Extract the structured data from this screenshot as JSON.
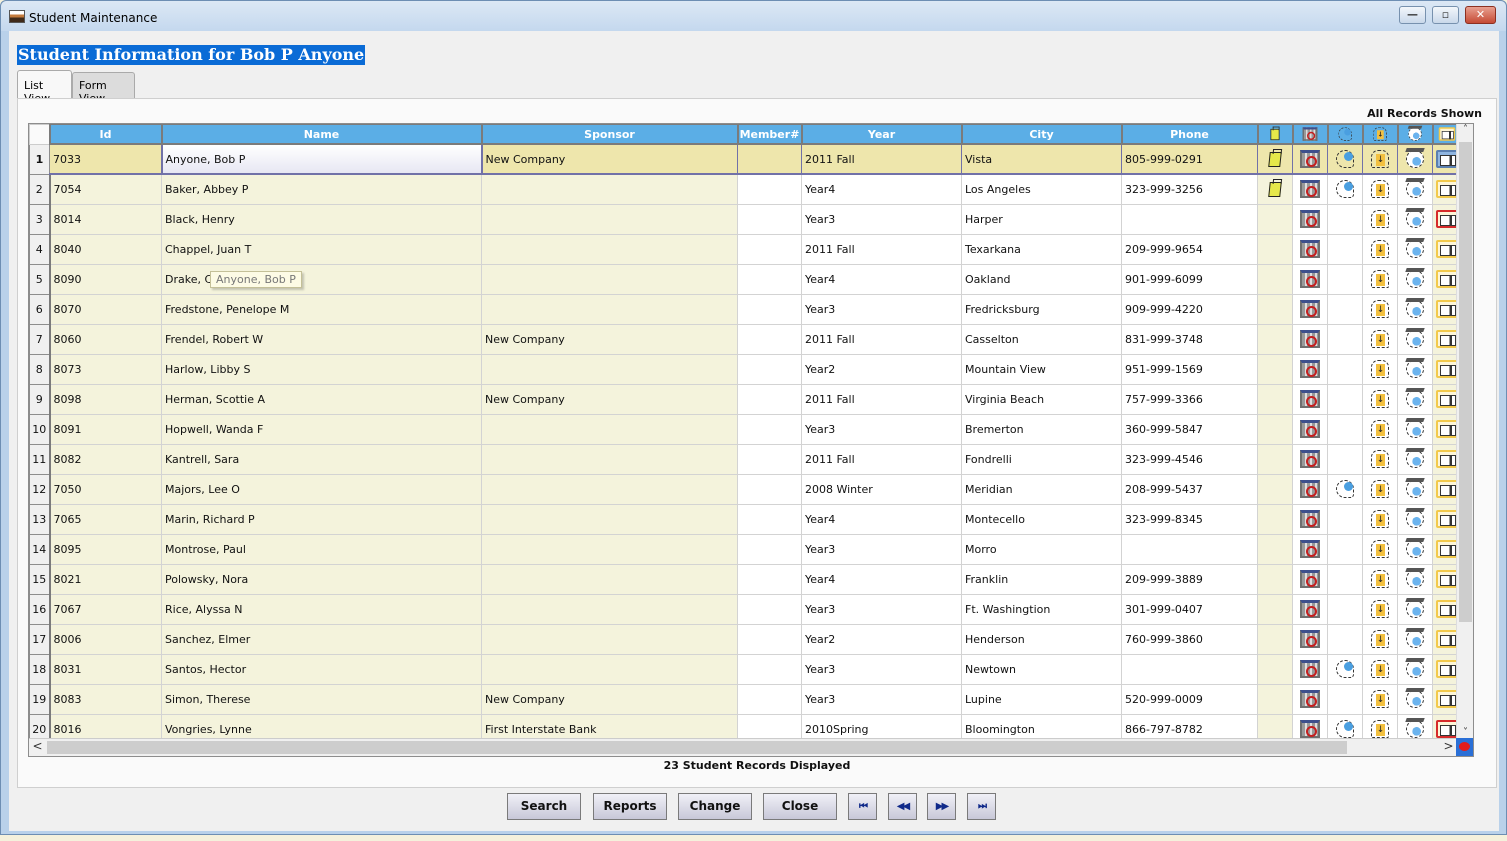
{
  "window": {
    "title": "Student Maintenance",
    "controls": {
      "minimize": "—",
      "maximize": "▫",
      "close": "✕"
    }
  },
  "header": {
    "title": "Student Information  for Bob P Anyone"
  },
  "tabs": [
    {
      "label": "List View",
      "active": true
    },
    {
      "label": "Form View",
      "active": false
    }
  ],
  "grid": {
    "records_shown_label": "All Records Shown",
    "columns": [
      "Id",
      "Name",
      "Sponsor",
      "Member#",
      "Year",
      "City",
      "Phone"
    ],
    "icon_columns": [
      "notes-icon",
      "calendar-icon",
      "contact-icon",
      "enrollment-icon",
      "graduation-icon",
      "card-icon"
    ],
    "selected_row": 1,
    "tooltip": "Anyone, Bob P",
    "rows": [
      {
        "num": "1",
        "id": "7033",
        "name": "Anyone, Bob P",
        "sponsor": "New Company",
        "member": "",
        "year": "2011 Fall",
        "city": "Vista",
        "phone": "805-999-0291",
        "notes": true,
        "contact": true,
        "card": "blue"
      },
      {
        "num": "2",
        "id": "7054",
        "name": "Baker, Abbey P",
        "sponsor": "",
        "member": "",
        "year": "Year4",
        "city": "Los Angeles",
        "phone": "323-999-3256",
        "notes": true,
        "contact": true,
        "card": "yellow"
      },
      {
        "num": "3",
        "id": "8014",
        "name": "Black, Henry",
        "sponsor": "",
        "member": "",
        "year": "Year3",
        "city": "Harper",
        "phone": "",
        "notes": false,
        "contact": false,
        "card": "red"
      },
      {
        "num": "4",
        "id": "8040",
        "name": "Chappel, Juan T",
        "sponsor": "",
        "member": "",
        "year": "2011 Fall",
        "city": "Texarkana",
        "phone": "209-999-9654",
        "notes": false,
        "contact": false,
        "card": "yellow"
      },
      {
        "num": "5",
        "id": "8090",
        "name": "Drake, Cynthia",
        "sponsor": "",
        "member": "",
        "year": "Year4",
        "city": "Oakland",
        "phone": "901-999-6099",
        "notes": false,
        "contact": false,
        "card": "yellow"
      },
      {
        "num": "6",
        "id": "8070",
        "name": "Fredstone, Penelope M",
        "sponsor": "",
        "member": "",
        "year": "Year3",
        "city": "Fredricksburg",
        "phone": "909-999-4220",
        "notes": false,
        "contact": false,
        "card": "yellow"
      },
      {
        "num": "7",
        "id": "8060",
        "name": "Frendel, Robert W",
        "sponsor": "New Company",
        "member": "",
        "year": "2011 Fall",
        "city": "Casselton",
        "phone": "831-999-3748",
        "notes": false,
        "contact": false,
        "card": "yellow"
      },
      {
        "num": "8",
        "id": "8073",
        "name": "Harlow, Libby S",
        "sponsor": "",
        "member": "",
        "year": "Year2",
        "city": "Mountain View",
        "phone": "951-999-1569",
        "notes": false,
        "contact": false,
        "card": "yellow"
      },
      {
        "num": "9",
        "id": "8098",
        "name": "Herman, Scottie A",
        "sponsor": "New Company",
        "member": "",
        "year": "2011 Fall",
        "city": "Virginia Beach",
        "phone": "757-999-3366",
        "notes": false,
        "contact": false,
        "card": "yellow"
      },
      {
        "num": "10",
        "id": "8091",
        "name": "Hopwell, Wanda F",
        "sponsor": "",
        "member": "",
        "year": "Year3",
        "city": "Bremerton",
        "phone": "360-999-5847",
        "notes": false,
        "contact": false,
        "card": "yellow"
      },
      {
        "num": "11",
        "id": "8082",
        "name": "Kantrell, Sara",
        "sponsor": "",
        "member": "",
        "year": "2011 Fall",
        "city": "Fondrelli",
        "phone": "323-999-4546",
        "notes": false,
        "contact": false,
        "card": "yellow"
      },
      {
        "num": "12",
        "id": "7050",
        "name": "Majors, Lee O",
        "sponsor": "",
        "member": "",
        "year": "2008 Winter",
        "city": "Meridian",
        "phone": "208-999-5437",
        "notes": false,
        "contact": true,
        "card": "yellow"
      },
      {
        "num": "13",
        "id": "7065",
        "name": "Marin, Richard P",
        "sponsor": "",
        "member": "",
        "year": "Year4",
        "city": "Montecello",
        "phone": "323-999-8345",
        "notes": false,
        "contact": false,
        "card": "yellow"
      },
      {
        "num": "14",
        "id": "8095",
        "name": "Montrose, Paul",
        "sponsor": "",
        "member": "",
        "year": "Year3",
        "city": "Morro",
        "phone": "",
        "notes": false,
        "contact": false,
        "card": "yellow"
      },
      {
        "num": "15",
        "id": "8021",
        "name": "Polowsky, Nora",
        "sponsor": "",
        "member": "",
        "year": "Year4",
        "city": "Franklin",
        "phone": "209-999-3889",
        "notes": false,
        "contact": false,
        "card": "yellow"
      },
      {
        "num": "16",
        "id": "7067",
        "name": "Rice, Alyssa N",
        "sponsor": "",
        "member": "",
        "year": "Year3",
        "city": "Ft. Washingtion",
        "phone": "301-999-0407",
        "notes": false,
        "contact": false,
        "card": "yellow"
      },
      {
        "num": "17",
        "id": "8006",
        "name": "Sanchez, Elmer",
        "sponsor": "",
        "member": "",
        "year": "Year2",
        "city": "Henderson",
        "phone": "760-999-3860",
        "notes": false,
        "contact": false,
        "card": "yellow"
      },
      {
        "num": "18",
        "id": "8031",
        "name": "Santos, Hector",
        "sponsor": "",
        "member": "",
        "year": "Year3",
        "city": "Newtown",
        "phone": "",
        "notes": false,
        "contact": true,
        "card": "yellow"
      },
      {
        "num": "19",
        "id": "8083",
        "name": "Simon, Therese",
        "sponsor": "New Company",
        "member": "",
        "year": "Year3",
        "city": "Lupine",
        "phone": "520-999-0009",
        "notes": false,
        "contact": false,
        "card": "yellow"
      },
      {
        "num": "20",
        "id": "8016",
        "name": "Vongries, Lynne",
        "sponsor": "First Interstate Bank",
        "member": "",
        "year": "2010Spring",
        "city": "Bloomington",
        "phone": "866-797-8782",
        "notes": false,
        "contact": true,
        "card": "red"
      }
    ]
  },
  "status": {
    "text": "23 Student Records Displayed"
  },
  "buttons": {
    "search": "Search",
    "reports": "Reports",
    "change": "Change",
    "close": "Close",
    "first": "⏮",
    "prev": "◀◀",
    "next": "▶▶",
    "last": "⏭"
  },
  "scroll": {
    "up": "˄",
    "down": "˅",
    "left": "<",
    "right": ">"
  }
}
